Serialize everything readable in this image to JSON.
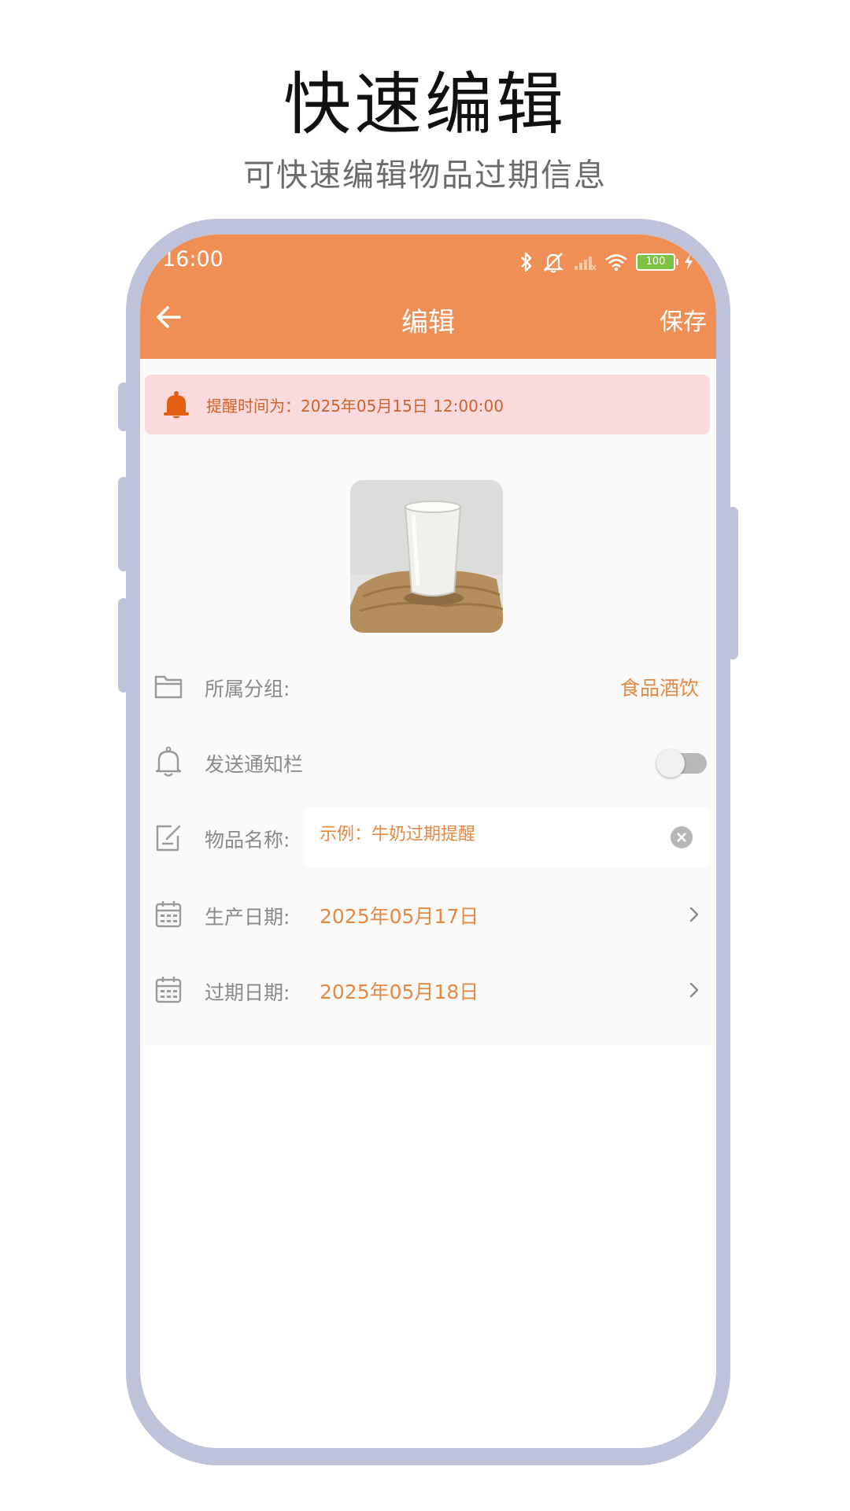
{
  "promo": {
    "title": "快速编辑",
    "subtitle": "可快速编辑物品过期信息"
  },
  "status_bar": {
    "time": "16:00",
    "battery": "100",
    "icons": [
      "bluetooth-icon",
      "mute-icon",
      "signal-icon",
      "wifi-icon",
      "battery-icon",
      "charging-icon"
    ]
  },
  "app_bar": {
    "title": "编辑",
    "save_label": "保存",
    "color": "#f08f55"
  },
  "reminder": {
    "text": "提醒时间为：2025年05月15日 12:00:00",
    "icon": "bell-icon"
  },
  "form": {
    "group": {
      "label": "所属分组:",
      "value": "食品酒饮",
      "icon": "folder-icon"
    },
    "notify": {
      "label": "发送通知栏",
      "enabled": false,
      "icon": "bell-outline-icon"
    },
    "name": {
      "label": "物品名称:",
      "placeholder": "示例：牛奶过期提醒",
      "value": "",
      "icon": "edit-icon"
    },
    "production_date": {
      "label": "生产日期:",
      "value": "2025年05月17日",
      "icon": "calendar-icon"
    },
    "expiry_date": {
      "label": "过期日期:",
      "value": "2025年05月18日",
      "icon": "calendar-icon"
    }
  },
  "colors": {
    "accent": "#e88840",
    "reminder_bg": "#fadadd",
    "frame": "#bec3da"
  }
}
